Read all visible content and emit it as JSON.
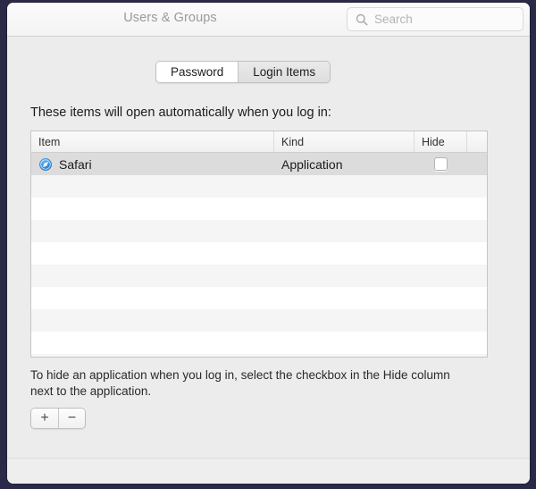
{
  "window": {
    "title": "Users & Groups"
  },
  "search": {
    "placeholder": "Search",
    "icon": "search-icon"
  },
  "tabs": [
    {
      "label": "Password",
      "selected": true
    },
    {
      "label": "Login Items",
      "selected": false
    }
  ],
  "intro_label": "These items will open automatically when you log in:",
  "table": {
    "columns": [
      "Item",
      "Kind",
      "Hide"
    ],
    "rows": [
      {
        "item": "Safari",
        "kind": "Application",
        "icon": "safari-compass-icon",
        "hide_checked": false,
        "selected": true
      }
    ],
    "empty_row_count": 8
  },
  "help_text": "To hide an application when you log in, select the checkbox in the Hide column next to the application.",
  "buttons": {
    "add_label": "+",
    "remove_label": "−"
  },
  "colors": {
    "window_background": "#ececec",
    "toolbar_background": "#f5f5f5",
    "table_background": "#ffffff",
    "row_stripe": "#f5f5f5",
    "selected_row": "#dcdcdc",
    "safari_icon_blue": "#2f7fd4",
    "title_text": "#9a9a9f",
    "body_text": "#1b1b1b",
    "window_border": "#2a2a48"
  }
}
